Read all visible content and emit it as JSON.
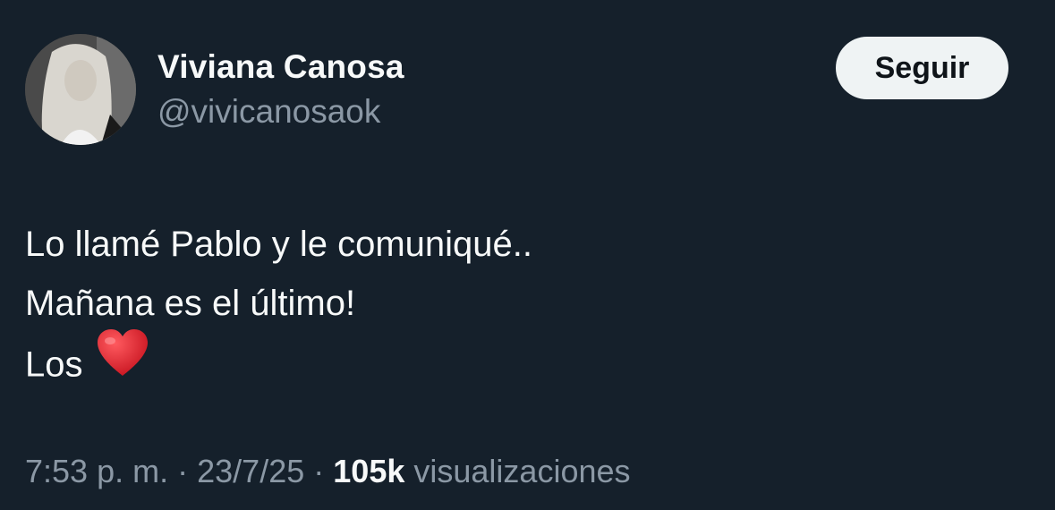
{
  "author": {
    "display_name": "Viviana Canosa",
    "handle": "@vivicanosaok",
    "avatar_icon": "profile-photo"
  },
  "follow_button": {
    "label": "Seguir"
  },
  "tweet": {
    "lines": [
      "Lo llamé Pablo y le comuniqué..",
      "Mañana es el último!",
      "Los"
    ],
    "emoji_icon": "red-heart-icon"
  },
  "meta": {
    "time": "7:53 p. m.",
    "separator": "·",
    "date": "23/7/25",
    "views_count": "105k",
    "views_label": "visualizaciones"
  },
  "colors": {
    "background": "#15202b",
    "primary_text": "#f7f9f9",
    "secondary_text": "#8b98a5",
    "button_bg": "#eff3f4",
    "heart": "#e0242e"
  }
}
